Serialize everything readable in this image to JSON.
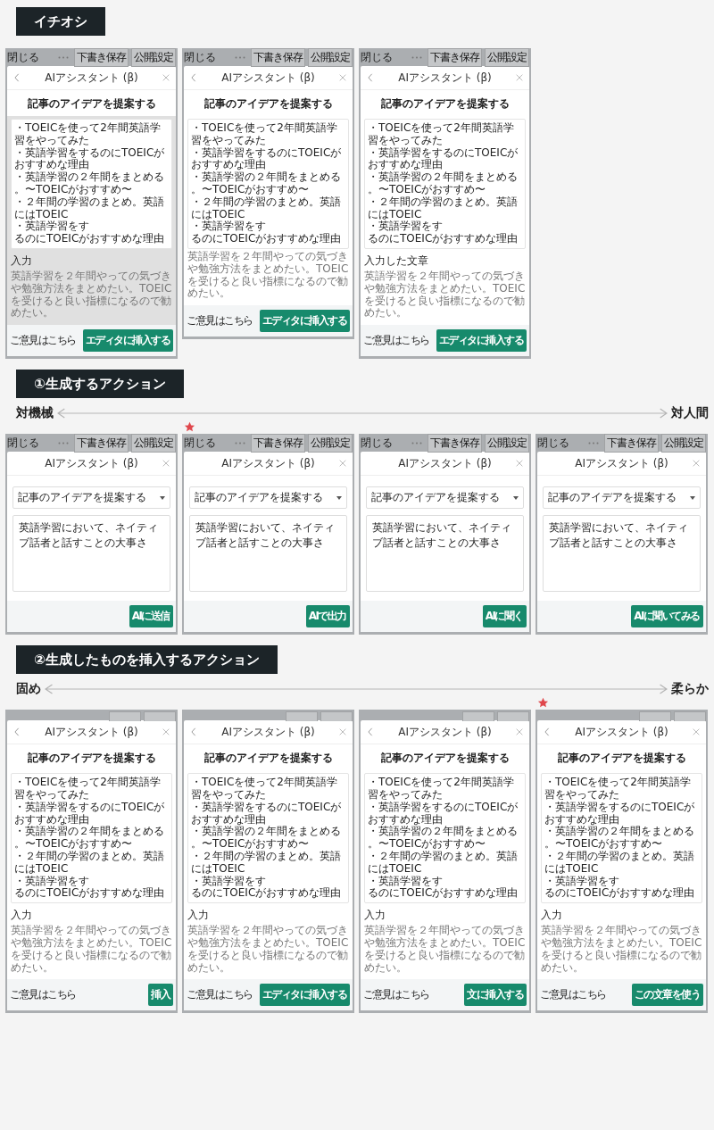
{
  "sections": [
    {
      "title": "イチオシ",
      "mockups": [
        {
          "kind": "result",
          "starred": false,
          "top_bar": {
            "covered": false,
            "close_label": "閉じる",
            "save_label": "下書き保存",
            "publish_label": "公開設定"
          },
          "dialog_title": "AIアシスタント (β)",
          "back_button": true,
          "shaded": true,
          "heading": "記事のアイデアを提案する",
          "ideas": [
            "・TOEICを使って2年間英語学習をやってみた",
            "・英語学習をするのにTOEICがおすすめな理由",
            "・英語学習の２年間をまとめる",
            "。〜TOEICがおすすめ〜",
            "・２年間の学習のまとめ。英語にはTOEIC",
            "・英語学習をす",
            "るのにTOEICがおすすめな理由"
          ],
          "input_label": "入力",
          "input_text": "英語学習を２年間やっての気づきや勉強方法をまとめたい。TOEICを受けると良い指標になるので勧めたい。",
          "feedback_link": "ご意見はこちら",
          "action_button": "エディタに挿入する"
        },
        {
          "kind": "result",
          "starred": false,
          "top_bar": {
            "covered": false,
            "close_label": "閉じる",
            "save_label": "下書き保存",
            "publish_label": "公開設定"
          },
          "dialog_title": "AIアシスタント (β)",
          "back_button": true,
          "shaded": false,
          "heading": "記事のアイデアを提案する",
          "ideas": [
            "・TOEICを使って2年間英語学習をやってみた",
            "・英語学習をするのにTOEICがおすすめな理由",
            "・英語学習の２年間をまとめる",
            "。〜TOEICがおすすめ〜",
            "・２年間の学習のまとめ。英語にはTOEIC",
            "・英語学習をす",
            "るのにTOEICがおすすめな理由"
          ],
          "input_text": "英語学習を２年間やっての気づきや勉強方法をまとめたい。TOEICを受けると良い指標になるので勧めたい。",
          "feedback_link": "ご意見はこちら",
          "action_button": "エディタに挿入する"
        },
        {
          "kind": "result",
          "starred": false,
          "top_bar": {
            "covered": false,
            "close_label": "閉じる",
            "save_label": "下書き保存",
            "publish_label": "公開設定"
          },
          "dialog_title": "AIアシスタント (β)",
          "back_button": true,
          "shaded": false,
          "heading": "記事のアイデアを提案する",
          "ideas": [
            "・TOEICを使って2年間英語学習をやってみた",
            "・英語学習をするのにTOEICがおすすめな理由",
            "・英語学習の２年間をまとめる",
            "。〜TOEICがおすすめ〜",
            "・２年間の学習のまとめ。英語にはTOEIC",
            "・英語学習をす",
            "るのにTOEICがおすすめな理由"
          ],
          "input_label": "入力した文章",
          "input_text": "英語学習を２年間やっての気づきや勉強方法をまとめたい。TOEICを受けると良い指標になるので勧めたい。",
          "feedback_link": "ご意見はこちら",
          "action_button": "エディタに挿入する"
        }
      ]
    },
    {
      "title": "①生成するアクション",
      "scale": {
        "left": "対機械",
        "right": "対人間"
      },
      "mockups": [
        {
          "kind": "form",
          "starred": false,
          "top_bar": {
            "covered": false,
            "close_label": "閉じる",
            "save_label": "下書き保存",
            "publish_label": "公開設定"
          },
          "dialog_title": "AIアシスタント (β)",
          "back_button": false,
          "select_value": "記事のアイデアを提案する",
          "prompt_text": "英語学習において、ネイティブ話者と話すことの大事さ",
          "action_button": "AIに送信"
        },
        {
          "kind": "form",
          "starred": true,
          "top_bar": {
            "covered": false,
            "close_label": "閉じる",
            "save_label": "下書き保存",
            "publish_label": "公開設定"
          },
          "dialog_title": "AIアシスタント (β)",
          "back_button": false,
          "select_value": "記事のアイデアを提案する",
          "prompt_text": "英語学習において、ネイティブ話者と話すことの大事さ",
          "action_button": "AIで出力"
        },
        {
          "kind": "form",
          "starred": false,
          "top_bar": {
            "covered": false,
            "close_label": "閉じる",
            "save_label": "下書き保存",
            "publish_label": "公開設定"
          },
          "dialog_title": "AIアシスタント (β)",
          "back_button": false,
          "select_value": "記事のアイデアを提案する",
          "prompt_text": "英語学習において、ネイティブ話者と話すことの大事さ",
          "action_button": "AIに聞く"
        },
        {
          "kind": "form",
          "starred": false,
          "top_bar": {
            "covered": false,
            "close_label": "閉じる",
            "save_label": "下書き保存",
            "publish_label": "公開設定"
          },
          "dialog_title": "AIアシスタント (β)",
          "back_button": false,
          "select_value": "記事のアイデアを提案する",
          "prompt_text": "英語学習において、ネイティブ話者と話すことの大事さ",
          "action_button": "AIに聞いてみる"
        }
      ]
    },
    {
      "title": "②生成したものを挿入するアクション",
      "scale": {
        "left": "固め",
        "right": "柔らか"
      },
      "mockups": [
        {
          "kind": "result",
          "starred": false,
          "top_bar": {
            "covered": true
          },
          "dialog_title": "AIアシスタント (β)",
          "back_button": true,
          "shaded": false,
          "heading": "記事のアイデアを提案する",
          "ideas": [
            "・TOEICを使って2年間英語学習をやってみた",
            "・英語学習をするのにTOEICがおすすめな理由",
            "・英語学習の２年間をまとめる",
            "。〜TOEICがおすすめ〜",
            "・２年間の学習のまとめ。英語にはTOEIC",
            "・英語学習をす",
            "るのにTOEICがおすすめな理由"
          ],
          "input_label": "入力",
          "input_text": "英語学習を２年間やっての気づきや勉強方法をまとめたい。TOEICを受けると良い指標になるので勧めたい。",
          "feedback_link": "ご意見はこちら",
          "action_button": "挿入"
        },
        {
          "kind": "result",
          "starred": false,
          "top_bar": {
            "covered": true
          },
          "dialog_title": "AIアシスタント (β)",
          "back_button": true,
          "shaded": false,
          "heading": "記事のアイデアを提案する",
          "ideas": [
            "・TOEICを使って2年間英語学習をやってみた",
            "・英語学習をするのにTOEICがおすすめな理由",
            "・英語学習の２年間をまとめる",
            "。〜TOEICがおすすめ〜",
            "・２年間の学習のまとめ。英語にはTOEIC",
            "・英語学習をす",
            "るのにTOEICがおすすめな理由"
          ],
          "input_label": "入力",
          "input_text": "英語学習を２年間やっての気づきや勉強方法をまとめたい。TOEICを受けると良い指標になるので勧めたい。",
          "feedback_link": "ご意見はこちら",
          "action_button": "エディタに挿入する"
        },
        {
          "kind": "result",
          "starred": false,
          "top_bar": {
            "covered": true
          },
          "dialog_title": "AIアシスタント (β)",
          "back_button": true,
          "shaded": false,
          "heading": "記事のアイデアを提案する",
          "ideas": [
            "・TOEICを使って2年間英語学習をやってみた",
            "・英語学習をするのにTOEICがおすすめな理由",
            "・英語学習の２年間をまとめる",
            "。〜TOEICがおすすめ〜",
            "・２年間の学習のまとめ。英語にはTOEIC",
            "・英語学習をす",
            "るのにTOEICがおすすめな理由"
          ],
          "input_label": "入力",
          "input_text": "英語学習を２年間やっての気づきや勉強方法をまとめたい。TOEICを受けると良い指標になるので勧めたい。",
          "feedback_link": "ご意見はこちら",
          "action_button": "文に挿入する"
        },
        {
          "kind": "result",
          "starred": true,
          "top_bar": {
            "covered": true
          },
          "dialog_title": "AIアシスタント (β)",
          "back_button": true,
          "shaded": false,
          "heading": "記事のアイデアを提案する",
          "ideas": [
            "・TOEICを使って2年間英語学習をやってみた",
            "・英語学習をするのにTOEICがおすすめな理由",
            "・英語学習の２年間をまとめる",
            "。〜TOEICがおすすめ〜",
            "・２年間の学習のまとめ。英語にはTOEIC",
            "・英語学習をす",
            "るのにTOEICがおすすめな理由"
          ],
          "input_label": "入力",
          "input_text": "英語学習を２年間やっての気づきや勉強方法をまとめたい。TOEICを受けると良い指標になるので勧めたい。",
          "feedback_link": "ご意見はこちら",
          "action_button": "この文章を使う"
        }
      ]
    }
  ]
}
